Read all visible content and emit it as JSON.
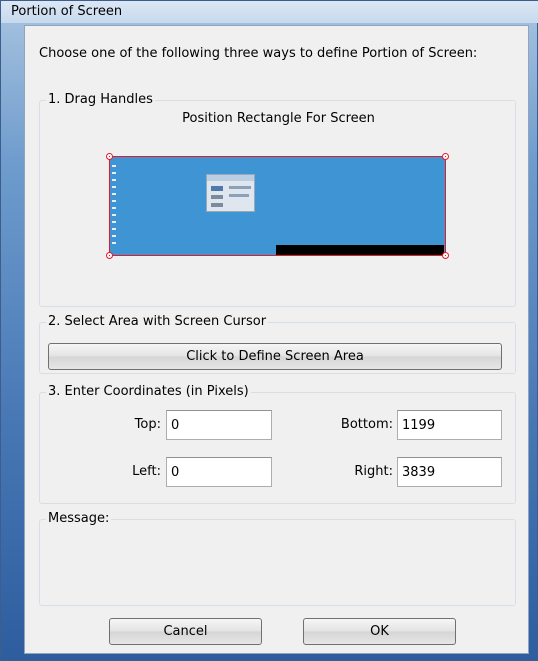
{
  "window": {
    "title": "Portion of Screen"
  },
  "intro": "Choose one of the following three ways to define Portion of Screen:",
  "drag_handles": {
    "legend": "1. Drag Handles",
    "subtitle": "Position Rectangle For Screen"
  },
  "select_area": {
    "legend": "2. Select Area with Screen Cursor",
    "button_label": "Click to Define Screen Area"
  },
  "coordinates": {
    "legend": "3. Enter Coordinates (in Pixels)",
    "top_label": "Top:",
    "top_value": "0",
    "bottom_label": "Bottom:",
    "bottom_value": "1199",
    "left_label": "Left:",
    "left_value": "0",
    "right_label": "Right:",
    "right_value": "3839"
  },
  "message": {
    "legend": "Message:"
  },
  "buttons": {
    "cancel": "Cancel",
    "ok": "OK"
  },
  "colors": {
    "preview_fill": "#3f94d4",
    "preview_border": "#e81b25",
    "taskbar": "#000000"
  }
}
